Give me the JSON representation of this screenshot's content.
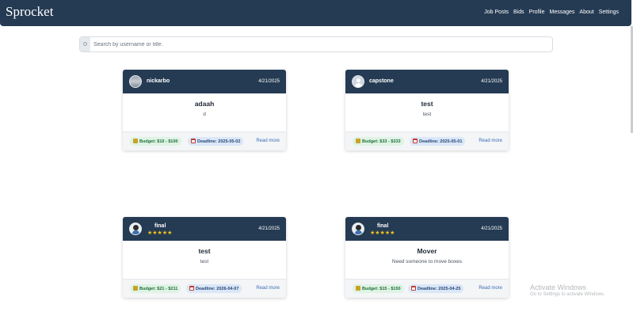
{
  "app": {
    "brand": "Sprocket"
  },
  "nav": {
    "links": [
      "Job Posts",
      "Bids",
      "Profile",
      "Messages",
      "About",
      "Settings"
    ]
  },
  "search": {
    "placeholder": "Search by username or title."
  },
  "cards": [
    {
      "username": "nickarbo",
      "avatar": "photo-avatar",
      "rating": null,
      "date": "4/21/2025",
      "title": "adaah",
      "description": "d",
      "budget": "Budget: $10 - $100",
      "deadline": "Deadline: 2025-05-02",
      "read_more": "Read more"
    },
    {
      "username": "capstone",
      "avatar": "default-user-avatar",
      "rating": null,
      "date": "4/21/2025",
      "title": "test",
      "description": "test",
      "budget": "Budget: $33 - $333",
      "deadline": "Deadline: 2025-05-01",
      "read_more": "Read more"
    },
    {
      "username": "final",
      "avatar": "cartoon-avatar",
      "rating": "★★★★★",
      "date": "4/21/2025",
      "title": "test",
      "description": "test",
      "budget": "Budget: $21 - $211",
      "deadline": "Deadline: 2026-04-07",
      "read_more": "Read more"
    },
    {
      "username": "final",
      "avatar": "cartoon-avatar",
      "rating": "★★★★★",
      "date": "4/21/2025",
      "title": "Mover",
      "description": "Need someone to move boxes",
      "budget": "Budget: $15 - $150",
      "deadline": "Deadline: 2025-04-25",
      "read_more": "Read more"
    }
  ],
  "watermark": {
    "title": "Activate Windows",
    "subtitle": "Go to Settings to activate Windows."
  },
  "colors": {
    "navbar": "#253b53",
    "budget_bg": "#dff3e4",
    "deadline_bg": "#dbe7f7",
    "star": "#f5c518",
    "link": "#3b6fb6"
  }
}
